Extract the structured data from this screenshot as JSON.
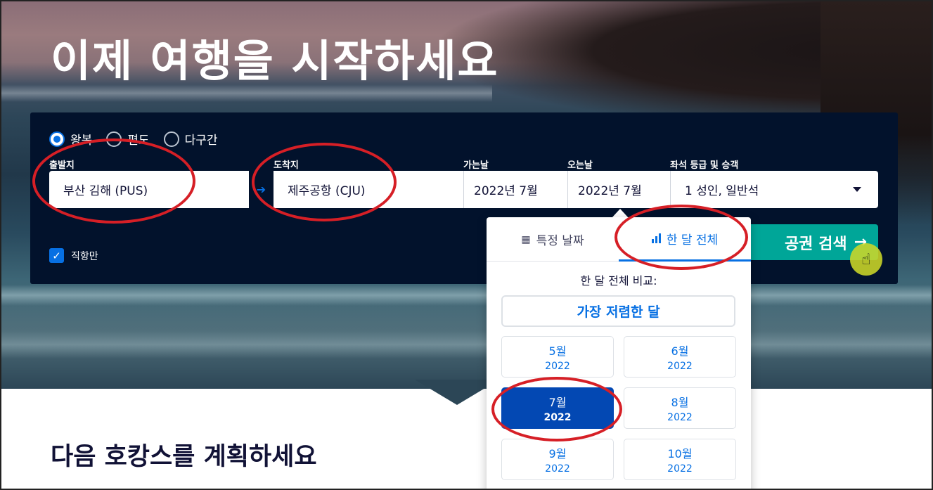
{
  "hero": {
    "title": "이제 여행을 시작하세요"
  },
  "search": {
    "trip_types": [
      {
        "label": "왕복",
        "checked": true
      },
      {
        "label": "편도",
        "checked": false
      },
      {
        "label": "다구간",
        "checked": false
      }
    ],
    "origin": {
      "label": "출발지",
      "value": "부산 김해 (PUS)"
    },
    "swap_icon": "➔",
    "destination": {
      "label": "도착지",
      "value": "제주공항 (CJU)"
    },
    "depart": {
      "label": "가는날",
      "value": "2022년 7월"
    },
    "return": {
      "label": "오는날",
      "value": "2022년 7월"
    },
    "cabin": {
      "label": "좌석 등급 및 승객",
      "value": "1 성인, 일반석"
    },
    "direct_only": {
      "label": "직항만",
      "checked": true
    },
    "search_button": {
      "label": "공권 검색",
      "arrow": "→"
    }
  },
  "calendar": {
    "tabs": [
      {
        "label": "특정 날짜",
        "icon": "calendar-icon",
        "active": false
      },
      {
        "label": "한 달 전체",
        "icon": "bar-chart-icon",
        "active": true
      }
    ],
    "compare_label": "한 달 전체 비교:",
    "cheapest_label": "가장 저렴한 달",
    "months": [
      {
        "month": "5월",
        "year": "2022",
        "selected": false
      },
      {
        "month": "6월",
        "year": "2022",
        "selected": false
      },
      {
        "month": "7월",
        "year": "2022",
        "selected": true
      },
      {
        "month": "8월",
        "year": "2022",
        "selected": false
      },
      {
        "month": "9월",
        "year": "2022",
        "selected": false
      },
      {
        "month": "10월",
        "year": "2022",
        "selected": false
      }
    ]
  },
  "next_section": {
    "title": "다음 호캉스를 계획하세요"
  },
  "colors": {
    "panel": "#02122c",
    "accent": "#0770e3",
    "search_button": "#00a698",
    "annotation": "#d61f26"
  }
}
